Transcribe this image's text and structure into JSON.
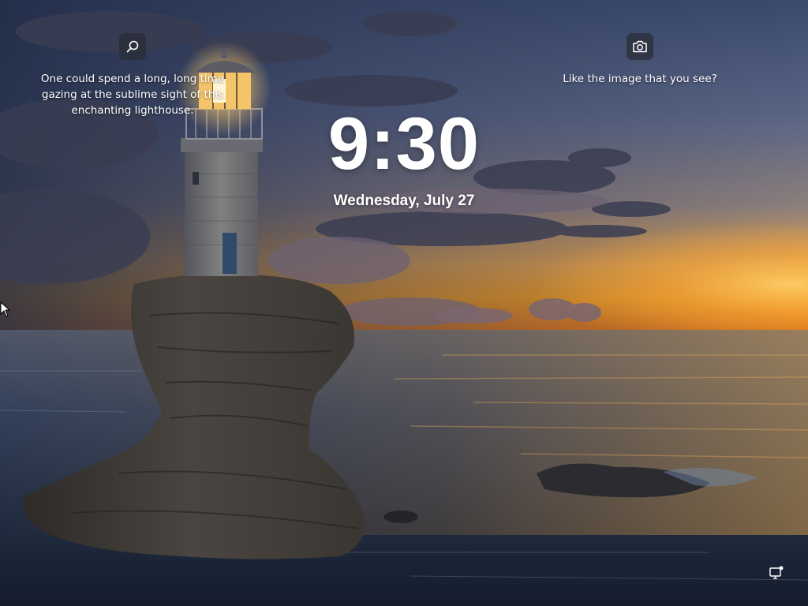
{
  "lock_screen": {
    "time": "9:30",
    "date": "Wednesday, July 27"
  },
  "spotlight": {
    "info_text": "One could spend a long, long time gazing at the sublime sight of this enchanting lighthouse.",
    "info_icon": "search-icon",
    "like_text": "Like the image that you see?",
    "like_icon": "camera-icon"
  },
  "system_tray": {
    "network_icon": "network-status-icon"
  },
  "colors": {
    "text": "#ffffff",
    "sunset_orange": "#f29a1c",
    "sea_blue": "#1b2c42"
  }
}
